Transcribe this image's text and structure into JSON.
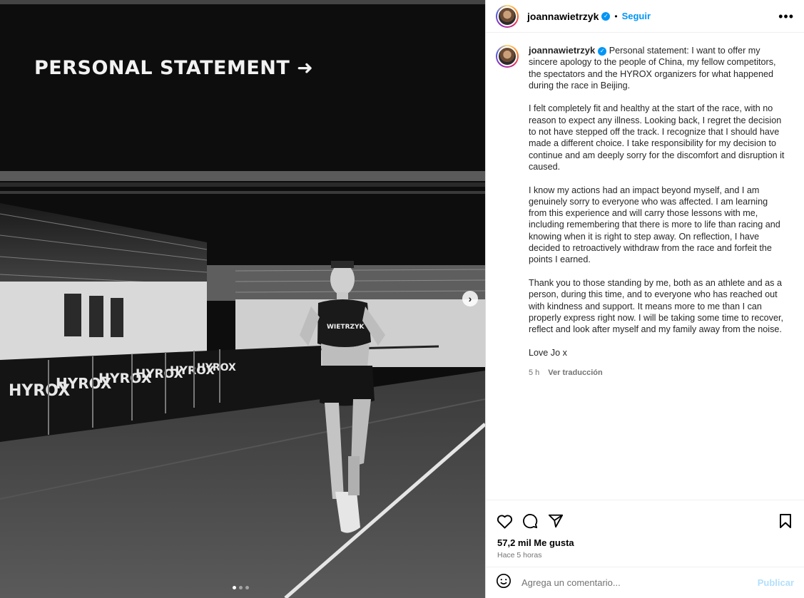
{
  "media": {
    "overlay_title": "PERSONAL STATEMENT ➜",
    "next_icon": "chevron-right-icon",
    "slide_count": 3,
    "active_slide": 1,
    "banner_text": "HYROX",
    "bib_text": "WIETRZYK"
  },
  "header": {
    "username": "joannawietrzyk",
    "separator": "•",
    "follow_label": "Seguir",
    "more_icon": "more-options-icon",
    "more_glyph": "•••"
  },
  "caption": {
    "username": "joannawietrzyk",
    "paragraphs": [
      "Personal statement: I want to offer my sincere apology to the people of China, my fellow competitors, the spectators and the HYROX organizers for what happened during the race in Beijing.",
      "I felt completely fit and healthy at the start of the race, with no reason to expect any illness. Looking back, I regret the decision to not have stepped off the track. I recognize that I should have made a different choice. I take responsibility for my decision to continue and am deeply sorry for the discomfort and disruption it caused.",
      "I know my actions had an impact beyond myself, and I am genuinely sorry to everyone who was affected. I am learning from this experience and will carry those lessons with me, including remembering that there is more to life than racing and knowing when it is right to step away. On reflection, I have decided to retroactively withdraw from the race and forfeit the points I earned.",
      "Thank you to those standing by me, both as an athlete and as a person, during this time, and to everyone who has reached out with kindness and support. It means more to me than I can properly express right now. I will be taking some time to recover, reflect and look after myself and my family away from the noise.",
      "Love Jo x"
    ],
    "time_ago": "5 h",
    "translate_label": "Ver traducción"
  },
  "actions": {
    "likes": "57,2 mil Me gusta",
    "posted": "Hace 5 horas"
  },
  "comment": {
    "placeholder": "Agrega un comentario...",
    "publish_label": "Publicar"
  },
  "colors": {
    "accent": "#0095f6",
    "publish_disabled": "#b2dffc",
    "muted": "#737373"
  }
}
